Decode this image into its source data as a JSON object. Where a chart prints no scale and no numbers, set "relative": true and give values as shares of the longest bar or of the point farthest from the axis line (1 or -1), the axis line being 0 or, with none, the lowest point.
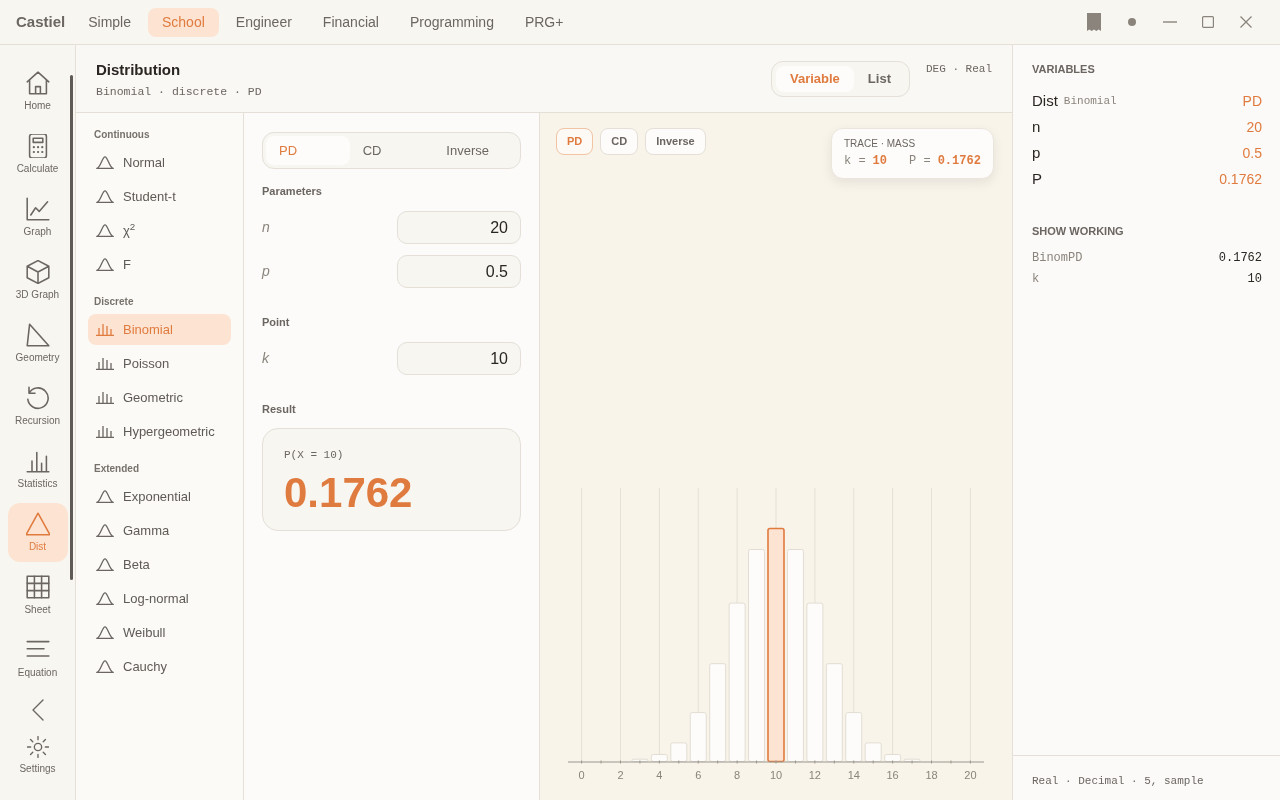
{
  "app": {
    "title": "Castiel"
  },
  "mode_tabs": [
    {
      "label": "Simple",
      "selected": false
    },
    {
      "label": "School",
      "selected": true
    },
    {
      "label": "Engineer",
      "selected": false
    },
    {
      "label": "Financial",
      "selected": false
    },
    {
      "label": "Programming",
      "selected": false
    },
    {
      "label": "PRG+",
      "selected": false
    }
  ],
  "nav": {
    "items": [
      {
        "label": "Home",
        "selected": false
      },
      {
        "label": "Calculate",
        "selected": false
      },
      {
        "label": "Graph",
        "selected": false
      },
      {
        "label": "3D Graph",
        "selected": false
      },
      {
        "label": "Geometry",
        "selected": false
      },
      {
        "label": "Recursion",
        "selected": false
      },
      {
        "label": "Statistics",
        "selected": false
      },
      {
        "label": "Dist",
        "selected": true
      },
      {
        "label": "Sheet",
        "selected": false
      },
      {
        "label": "Equation",
        "selected": false
      }
    ],
    "settings": {
      "label": "Settings"
    }
  },
  "header": {
    "title": "Distribution",
    "subtitle": "Binomial · discrete · PD",
    "view_tabs": [
      {
        "label": "Variable",
        "selected": true
      },
      {
        "label": "List",
        "selected": false
      }
    ],
    "mode": "DEG · Real"
  },
  "distributions": {
    "groups": [
      {
        "heading": "Continuous",
        "items": [
          {
            "label": "Normal",
            "kind": "continuous",
            "selected": false
          },
          {
            "label": "Student-t",
            "kind": "continuous",
            "selected": false
          },
          {
            "label": "χ$^{2}$",
            "kind": "continuous",
            "selected": false
          },
          {
            "label": "F",
            "kind": "continuous",
            "selected": false
          }
        ]
      },
      {
        "heading": "Discrete",
        "items": [
          {
            "label": "Binomial",
            "kind": "discrete",
            "selected": true
          },
          {
            "label": "Poisson",
            "kind": "discrete",
            "selected": false
          },
          {
            "label": "Geometric",
            "kind": "discrete",
            "selected": false
          },
          {
            "label": "Hypergeometric",
            "kind": "discrete",
            "selected": false
          }
        ]
      },
      {
        "heading": "Extended",
        "items": [
          {
            "label": "Exponential",
            "kind": "continuous",
            "selected": false
          },
          {
            "label": "Gamma",
            "kind": "continuous",
            "selected": false
          },
          {
            "label": "Beta",
            "kind": "continuous",
            "selected": false
          },
          {
            "label": "Log-normal",
            "kind": "continuous",
            "selected": false
          },
          {
            "label": "Weibull",
            "kind": "continuous",
            "selected": false
          },
          {
            "label": "Cauchy",
            "kind": "continuous",
            "selected": false
          }
        ]
      }
    ]
  },
  "calculator": {
    "function_tabs": [
      {
        "label": "PD",
        "selected": true
      },
      {
        "label": "CD",
        "selected": false
      },
      {
        "label": "Inverse",
        "selected": false
      }
    ],
    "sections": [
      {
        "heading": "Parameters",
        "fields": [
          {
            "label": "n",
            "value": "20"
          },
          {
            "label": "p",
            "value": "0.5"
          }
        ]
      },
      {
        "heading": "Point",
        "fields": [
          {
            "label": "k",
            "value": "10"
          }
        ]
      }
    ],
    "result": {
      "heading": "Result",
      "expression": "P(X = 10)",
      "value": "0.1762"
    }
  },
  "plot": {
    "function_buttons": [
      {
        "label": "PD",
        "selected": true
      },
      {
        "label": "CD",
        "selected": false
      },
      {
        "label": "Inverse",
        "selected": false
      }
    ],
    "trace": {
      "title": "TRACE · MASS",
      "k_label": "k =",
      "k_value": "10",
      "p_label": "P =",
      "p_value": "0.1762"
    },
    "chart_data": {
      "type": "bar",
      "x": [
        0,
        1,
        2,
        3,
        4,
        5,
        6,
        7,
        8,
        9,
        10,
        11,
        12,
        13,
        14,
        15,
        16,
        17,
        18,
        19,
        20
      ],
      "values": [
        0,
        0,
        0,
        0.01,
        0.03,
        0.08,
        0.21,
        0.42,
        0.68,
        0.91,
        1,
        0.91,
        0.68,
        0.42,
        0.21,
        0.08,
        0.03,
        0.01,
        0,
        0,
        0
      ],
      "relative": true,
      "xlim": [
        -0.7,
        20.7
      ],
      "xticks": [
        0,
        2,
        4,
        6,
        8,
        10,
        12,
        14,
        16,
        18,
        20
      ],
      "grid": true
    }
  },
  "variables": {
    "heading": "VARIABLES",
    "rows": [
      {
        "name": "Dist",
        "detail": "Binomial",
        "value": "PD"
      },
      {
        "name": "n",
        "value": "20"
      },
      {
        "name": "p",
        "value": "0.5"
      },
      {
        "name": "P",
        "value": "0.1762"
      }
    ]
  },
  "working": {
    "heading": "SHOW WORKING",
    "rows": [
      {
        "name": "BinomPD",
        "value": "0.1762"
      },
      {
        "name": "k",
        "value": "10"
      }
    ]
  },
  "status_bar": "Real · Decimal · 5, sample"
}
